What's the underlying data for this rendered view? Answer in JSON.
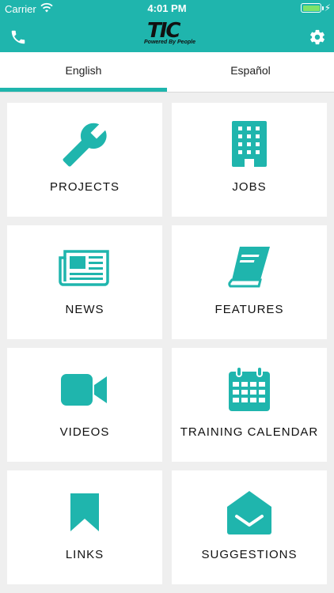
{
  "status_bar": {
    "carrier": "Carrier",
    "time": "4:01 PM"
  },
  "header": {
    "logo_text": "TIC",
    "logo_tagline": "Powered By People",
    "icons": [
      "phone-icon",
      "gear-icon"
    ]
  },
  "tabs": [
    {
      "label": "English",
      "active": true
    },
    {
      "label": "Español",
      "active": false
    }
  ],
  "accent_color": "#1fb5ad",
  "tiles": [
    {
      "label": "PROJECTS",
      "icon": "wrench-icon"
    },
    {
      "label": "JOBS",
      "icon": "building-icon"
    },
    {
      "label": "NEWS",
      "icon": "newspaper-icon"
    },
    {
      "label": "FEATURES",
      "icon": "book-icon"
    },
    {
      "label": "VIDEOS",
      "icon": "video-camera-icon"
    },
    {
      "label": "TRAINING CALENDAR",
      "icon": "calendar-icon"
    },
    {
      "label": "LINKS",
      "icon": "bookmark-icon"
    },
    {
      "label": "SUGGESTIONS",
      "icon": "envelope-open-icon"
    }
  ]
}
